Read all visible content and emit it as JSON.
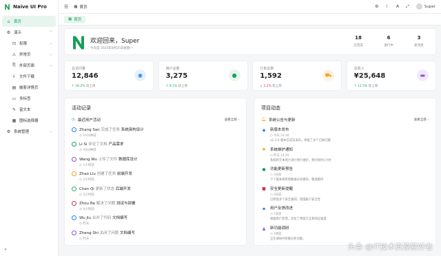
{
  "app": {
    "title": "Naive UI Pro"
  },
  "sidebar": {
    "items": [
      {
        "label": "首页",
        "icon": "home-icon",
        "active": true
      },
      {
        "label": "演示",
        "icon": "gear-icon",
        "expandable": true,
        "chevron": "⌃"
      },
      {
        "label": "权限",
        "icon": "lock-icon",
        "sub": true,
        "expandable": true,
        "chevron": "⌄"
      },
      {
        "label": "异常页",
        "icon": "warning-icon",
        "sub": true,
        "expandable": true,
        "chevron": "⌄"
      },
      {
        "label": "外部页面",
        "icon": "link-icon",
        "sub": true,
        "expandable": true,
        "chevron": "⌄"
      },
      {
        "label": "文件下载",
        "icon": "download-icon",
        "sub": true
      },
      {
        "label": "嵌套详情页",
        "icon": "document-icon",
        "sub": true
      },
      {
        "label": "多标签",
        "icon": "folder-icon",
        "sub": true
      },
      {
        "label": "富文本",
        "icon": "editor-icon",
        "sub": true
      },
      {
        "label": "图标选择器",
        "icon": "grid-icon",
        "sub": true
      },
      {
        "label": "系统管理",
        "icon": "settings-icon",
        "expandable": true,
        "chevron": "⌄"
      }
    ],
    "collapse_glyph": "«"
  },
  "header": {
    "breadcrumb": "首页",
    "user": "Super"
  },
  "tabs": [
    {
      "label": "首页"
    }
  ],
  "welcome": {
    "title": "欢迎回来，Super",
    "subtitle": "今天是 2025年8月25日星期一",
    "stats": [
      {
        "value": "18",
        "label": "已完成"
      },
      {
        "value": "6",
        "label": "进行中"
      },
      {
        "value": "3",
        "label": "新消息"
      }
    ]
  },
  "stats": [
    {
      "label": "总访问量",
      "value": "12,846",
      "trend": "16.2%",
      "dir": "up",
      "note": "较上周",
      "color": "#2080f0",
      "bg": "#e8f1fd",
      "icon": "eye-icon"
    },
    {
      "label": "用户总数",
      "value": "3,275",
      "trend": "8.1%",
      "dir": "up",
      "note": "较上周",
      "color": "#18a058",
      "bg": "#e7f5ee",
      "icon": "user-icon"
    },
    {
      "label": "订单总数",
      "value": "1,592",
      "trend": "3.2%",
      "dir": "down",
      "note": "较上周",
      "color": "#f0a020",
      "bg": "#fdf3e2",
      "icon": "cart-icon"
    },
    {
      "label": "总收入",
      "value": "¥25,648",
      "trend": "12.5%",
      "dir": "up",
      "note": "较上周",
      "color": "#8a4fd8",
      "bg": "#f1e9fb",
      "icon": "wallet-icon"
    }
  ],
  "activity": {
    "title": "活动记录",
    "section": "最近用户活动",
    "more": "查看全部 ›",
    "items": [
      {
        "who": "Zhang San",
        "verb": "完成了任务",
        "what": "系统架构设计",
        "time": "10分钟前",
        "color": "#2080f0"
      },
      {
        "who": "Li Si",
        "verb": "评论了文档",
        "what": "产品需求",
        "time": "30分钟前",
        "color": "#18a058"
      },
      {
        "who": "Wang Wu",
        "verb": "上传了文件",
        "what": "数据库设计",
        "time": "1小时前",
        "color": "#8a4fd8"
      },
      {
        "who": "Zhao Liu",
        "verb": "创建了任务",
        "what": "前端开发",
        "time": "2小时前",
        "color": "#f0a020"
      },
      {
        "who": "Chen Qi",
        "verb": "更新了状态",
        "what": "后端开发",
        "time": "3小时前",
        "color": "#36ad6a"
      },
      {
        "who": "Zhou Ba",
        "verb": "解决了问题",
        "what": "测试与部署",
        "time": "4小时前",
        "color": "#d03050"
      },
      {
        "who": "Wu Jiu",
        "verb": "合并了代码",
        "what": "文档编写",
        "time": "昨天",
        "color": "#2080f0"
      },
      {
        "who": "Zheng Shi",
        "verb": "关闭了问题",
        "what": "文档编写",
        "time": "昨天",
        "color": "#8a4fd8"
      }
    ]
  },
  "project": {
    "title": "项目动态",
    "section": "系统公告与更新",
    "more": "查看全部 ›",
    "items": [
      {
        "title": "新版本发布",
        "date": "今天 10:30",
        "desc": "v2.3.0 版本已成功发布，修复了多个已知问题",
        "icon": "rocket-icon",
        "glyph": "◆",
        "color": "#2080f0"
      },
      {
        "title": "系统维护通知",
        "date": "昨天 14:20",
        "desc": "系统将于本周六进行例行维护，预计耗时2小时",
        "icon": "wrench-icon",
        "glyph": "✖",
        "color": "#f0a020"
      },
      {
        "title": "功能更新预告",
        "date": "3天前",
        "desc": "下个版本将新增数据分析模块，敬请期待",
        "icon": "bulb-icon",
        "glyph": "●",
        "color": "#18a058"
      },
      {
        "title": "安全更新提醒",
        "date": "4天前",
        "desc": "已修复多个安全漏洞，增强账户安全性",
        "icon": "shield-icon",
        "glyph": "■",
        "color": "#d03050"
      },
      {
        "title": "用户反馈改进",
        "date": "5天前",
        "desc": "根据用户反馈，优化了界面交互和响应速度",
        "icon": "chat-icon",
        "glyph": "▪",
        "color": "#2080f0"
      },
      {
        "title": "新功能调研",
        "date": "1周前",
        "desc": "正在调研AI智能分析功能，",
        "icon": "flask-icon",
        "glyph": "▲",
        "color": "#8a4fd8"
      }
    ]
  },
  "watermark": "头条 @IT技术资源爱好者"
}
